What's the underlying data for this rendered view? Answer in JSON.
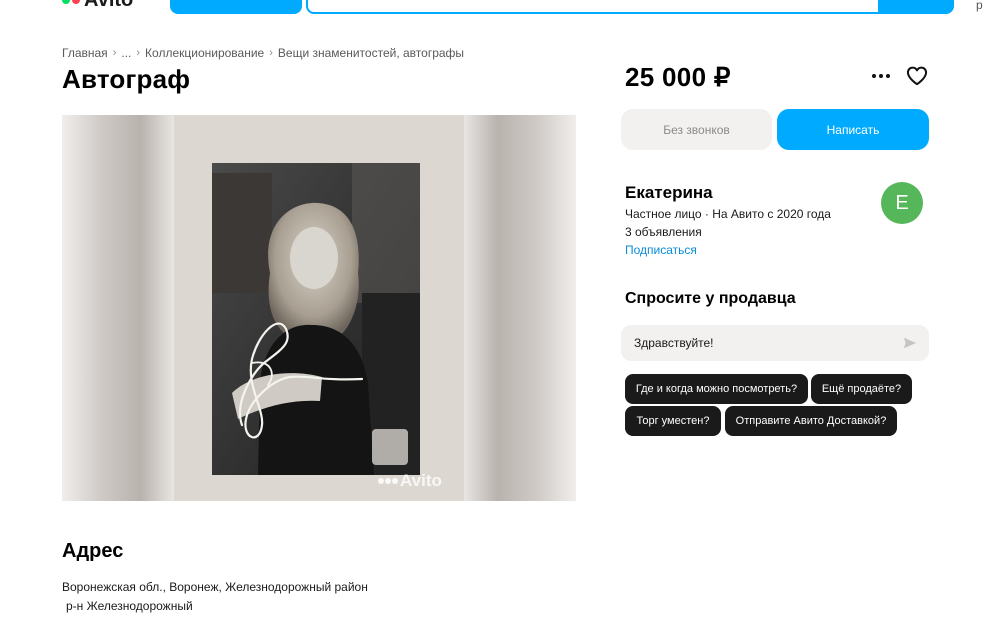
{
  "header": {
    "logo_text": "Avito",
    "logo_dot_colors": [
      "#04e061",
      "#ff4053",
      "#965eeb",
      "#0af"
    ],
    "cut_off_right_text": "р"
  },
  "breadcrumbs": [
    "Главная",
    "...",
    "Коллекционирование",
    "Вещи знаменитостей, автографы"
  ],
  "listing": {
    "title": "Автограф",
    "price": "25 000 ₽",
    "watermark": "Avito"
  },
  "actions": {
    "no_calls_label": "Без звонков",
    "write_label": "Написать"
  },
  "seller": {
    "name": "Екатерина",
    "meta": "Частное лицо · На Авито с 2020 года",
    "ads_count": "3 объявления",
    "subscribe_label": "Подписаться",
    "avatar_letter": "Е",
    "avatar_color": "#55b65a"
  },
  "ask": {
    "title": "Спросите у продавца",
    "message_value": "Здравствуйте!",
    "quick_questions": [
      "Где и когда можно посмотреть?",
      "Ещё продаёте?",
      "Торг уместен?",
      "Отправите Авито Доставкой?"
    ]
  },
  "address": {
    "title": "Адрес",
    "line1": "Воронежская обл., Воронеж, Железнодорожный район",
    "line2": "р-н Железнодорожный"
  },
  "colors": {
    "accent": "#00aaff",
    "link": "#0a8bd6",
    "chip_bg": "#1a1a1a"
  }
}
